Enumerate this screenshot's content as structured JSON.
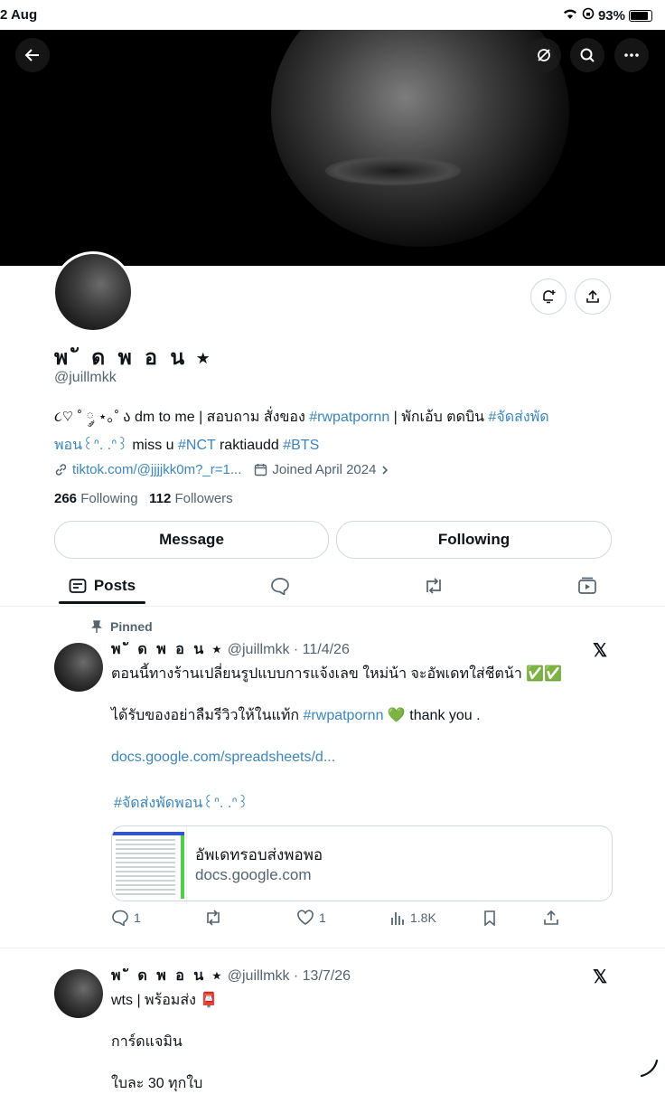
{
  "status": {
    "time": "2 Aug",
    "battery": "93%"
  },
  "profile": {
    "name": "พ ั ด พ อ น ⭒",
    "handle": "@juillmkk",
    "bio_line1_pre": "૮♡ ˚ ༘ ⋆｡˚ ა dm to me | สอบถาม สั่งของ ",
    "bio_tag1": "#rwpatpornn",
    "bio_line1_mid": " | พักเอ้บ ตดบิน ",
    "bio_tag2": "#จัดส่งพัด",
    "bio_tag2b": "พอน꒰ᐢ. .ᐢ꒱",
    "bio_mid2": " miss u ",
    "bio_tag3": "#NCT",
    "bio_mid3": " raktiaudd ",
    "bio_tag4": "#BTS",
    "link": "tiktok.com/@jjjjkk0m?_r=1...",
    "joined": "Joined April 2024",
    "following_count": "266",
    "following_label": "Following",
    "followers_count": "112",
    "followers_label": "Followers"
  },
  "buttons": {
    "message": "Message",
    "following": "Following"
  },
  "tabs": {
    "posts": "Posts"
  },
  "post1": {
    "pinned": "Pinned",
    "name": "พ ั ด พ อ น ⭒",
    "handle_date": "@juillmkk · 11/4/26",
    "line1": "ตอนนี้ทางร้านเปลี่ยนรูปแบบการแจ้งเลข ใหม่น้า จะอัพเดทใส่ชีตน้า ✅✅",
    "line2_pre": "ได้รับของอย่าลืมรีวิวให้ในแท้ก ",
    "line2_tag": "#rwpatpornn",
    "line2_post": " 💚 thank you .",
    "link": "docs.google.com/spreadsheets/d...",
    "tag": "#จัดส่งพัดพอน꒰ᐢ. .ᐢ꒱",
    "card_title": "อัพเดทรอบส่งพอพอ",
    "card_domain": "docs.google.com",
    "replies": "1",
    "likes": "1",
    "views": "1.8K"
  },
  "post2": {
    "name": "พ ั ด พ อ น ⭒",
    "handle_date": "@juillmkk · 13/7/26",
    "line1": "wts | พร้อมส่ง 📮",
    "line2": "การ์ดแจมิน",
    "line3": "ใบละ 30 ทุกใบ"
  }
}
